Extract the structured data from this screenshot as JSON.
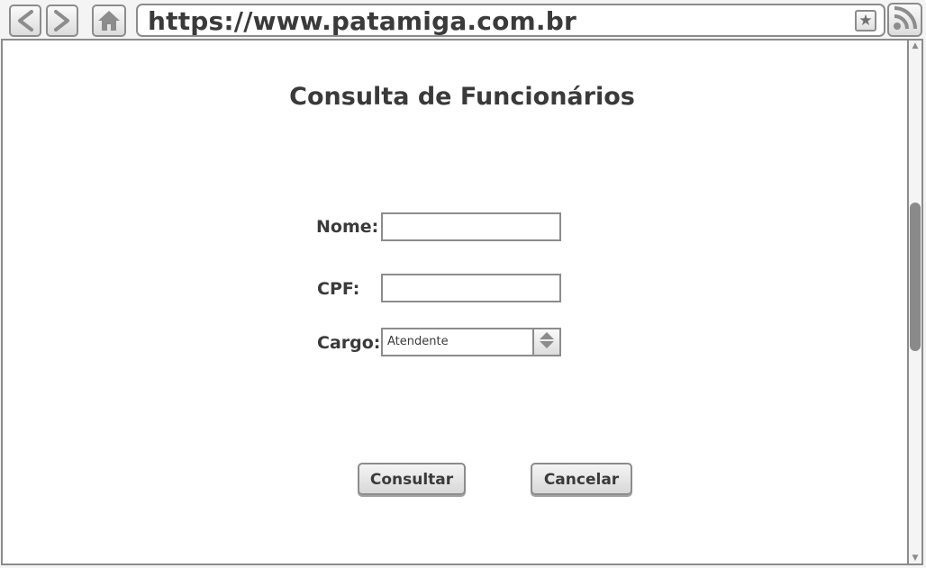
{
  "browser": {
    "url": "https://www.patamiga.com.br",
    "bookmark_glyph": "★",
    "icons": {
      "back": "chevron-left-icon",
      "forward": "chevron-right-icon",
      "home": "home-icon",
      "bookmark": "star-icon",
      "feed": "rss-icon"
    },
    "scroll_up_glyph": "▲",
    "scroll_down_glyph": "▼"
  },
  "page": {
    "title": "Consulta de Funcionários",
    "form": {
      "nome": {
        "label": "Nome:",
        "value": "",
        "placeholder": ""
      },
      "cpf": {
        "label": "CPF:",
        "value": "",
        "placeholder": ""
      },
      "cargo": {
        "label": "Cargo:",
        "selected": "Atendente"
      }
    },
    "buttons": {
      "consultar": "Consultar",
      "cancelar": "Cancelar"
    }
  },
  "colors": {
    "text": "#3a3a3a",
    "border": "#8c8c8c",
    "button_fill": "#dcdcdc",
    "background": "#ffffff"
  }
}
